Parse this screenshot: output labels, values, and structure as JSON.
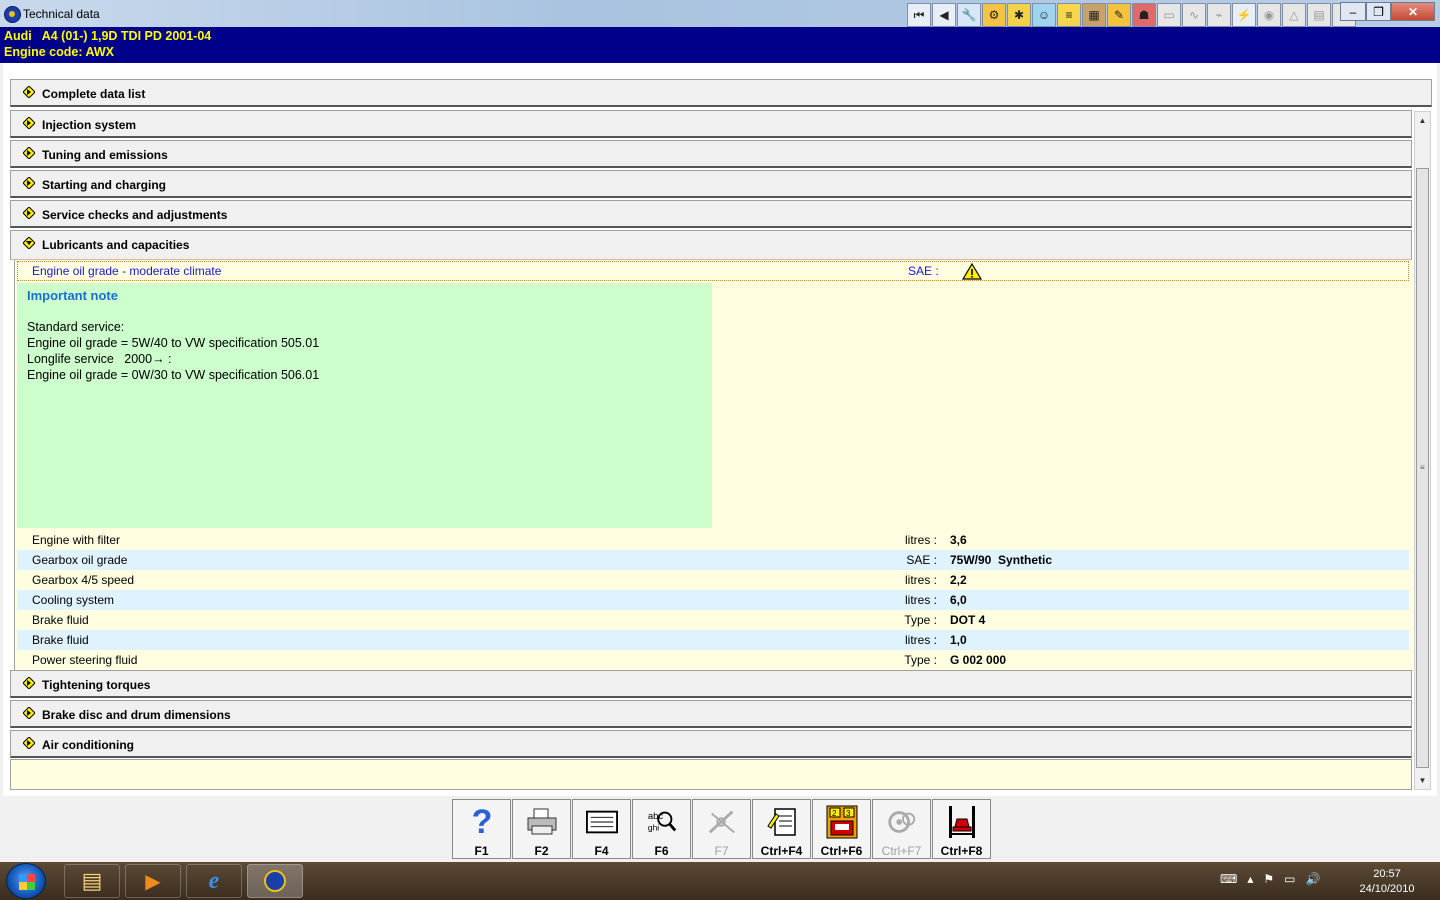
{
  "window": {
    "title": "Technical data"
  },
  "vehicle": {
    "line1": "Audi   A4 (01-) 1,9D TDI PD 2001-04",
    "line2": "Engine code: AWX"
  },
  "sections_top": [
    {
      "label": "Complete data list"
    },
    {
      "label": "Injection system"
    },
    {
      "label": "Tuning and emissions"
    },
    {
      "label": "Starting and charging"
    },
    {
      "label": "Service checks and adjustments"
    },
    {
      "label": "Lubricants and capacities"
    }
  ],
  "oil_grade": {
    "label": "Engine oil grade - moderate climate",
    "unit": "SAE :"
  },
  "note": {
    "title": "Important note",
    "lines": [
      "Standard service:",
      "Engine oil grade = 5W/40 to VW specification 505.01",
      "Longlife service   2000→ :",
      "Engine oil grade = 0W/30 to VW specification 506.01"
    ]
  },
  "rows": [
    {
      "label": "Engine with filter",
      "unit": "litres :",
      "value": "3,6"
    },
    {
      "label": "Gearbox oil grade",
      "unit": "SAE :",
      "value": "75W/90  Synthetic"
    },
    {
      "label": "Gearbox 4/5 speed",
      "unit": "litres :",
      "value": "2,2"
    },
    {
      "label": "Cooling system",
      "unit": "litres :",
      "value": "6,0"
    },
    {
      "label": "Brake fluid",
      "unit": "Type :",
      "value": "DOT 4"
    },
    {
      "label": "Brake fluid",
      "unit": "litres :",
      "value": "1,0"
    },
    {
      "label": "Power steering fluid",
      "unit": "Type :",
      "value": "G 002 000"
    }
  ],
  "sections_bottom": [
    {
      "label": "Tightening torques"
    },
    {
      "label": "Brake disc and drum dimensions"
    },
    {
      "label": "Air conditioning"
    }
  ],
  "fkeys": [
    {
      "label": "F1",
      "icon": "help-icon"
    },
    {
      "label": "F2",
      "icon": "printer-icon"
    },
    {
      "label": "F4",
      "icon": "document-icon"
    },
    {
      "label": "F6",
      "icon": "search-text-icon"
    },
    {
      "label": "F7",
      "icon": "tools-icon"
    },
    {
      "label": "Ctrl+F4",
      "icon": "notepad-icon"
    },
    {
      "label": "Ctrl+F6",
      "icon": "vehicle-select-icon"
    },
    {
      "label": "Ctrl+F7",
      "icon": "gears-icon"
    },
    {
      "label": "Ctrl+F8",
      "icon": "lift-icon"
    }
  ],
  "clock": {
    "time": "20:57",
    "date": "24/10/2010"
  },
  "colors": {
    "header_bg": "#00008b",
    "header_text": "#ffff00",
    "panel_bg": "#fffee0",
    "note_bg": "#ccffcc",
    "alt_row": "#dff3ff",
    "note_title": "#1a6fd0",
    "oil_label": "#1a1acc"
  }
}
